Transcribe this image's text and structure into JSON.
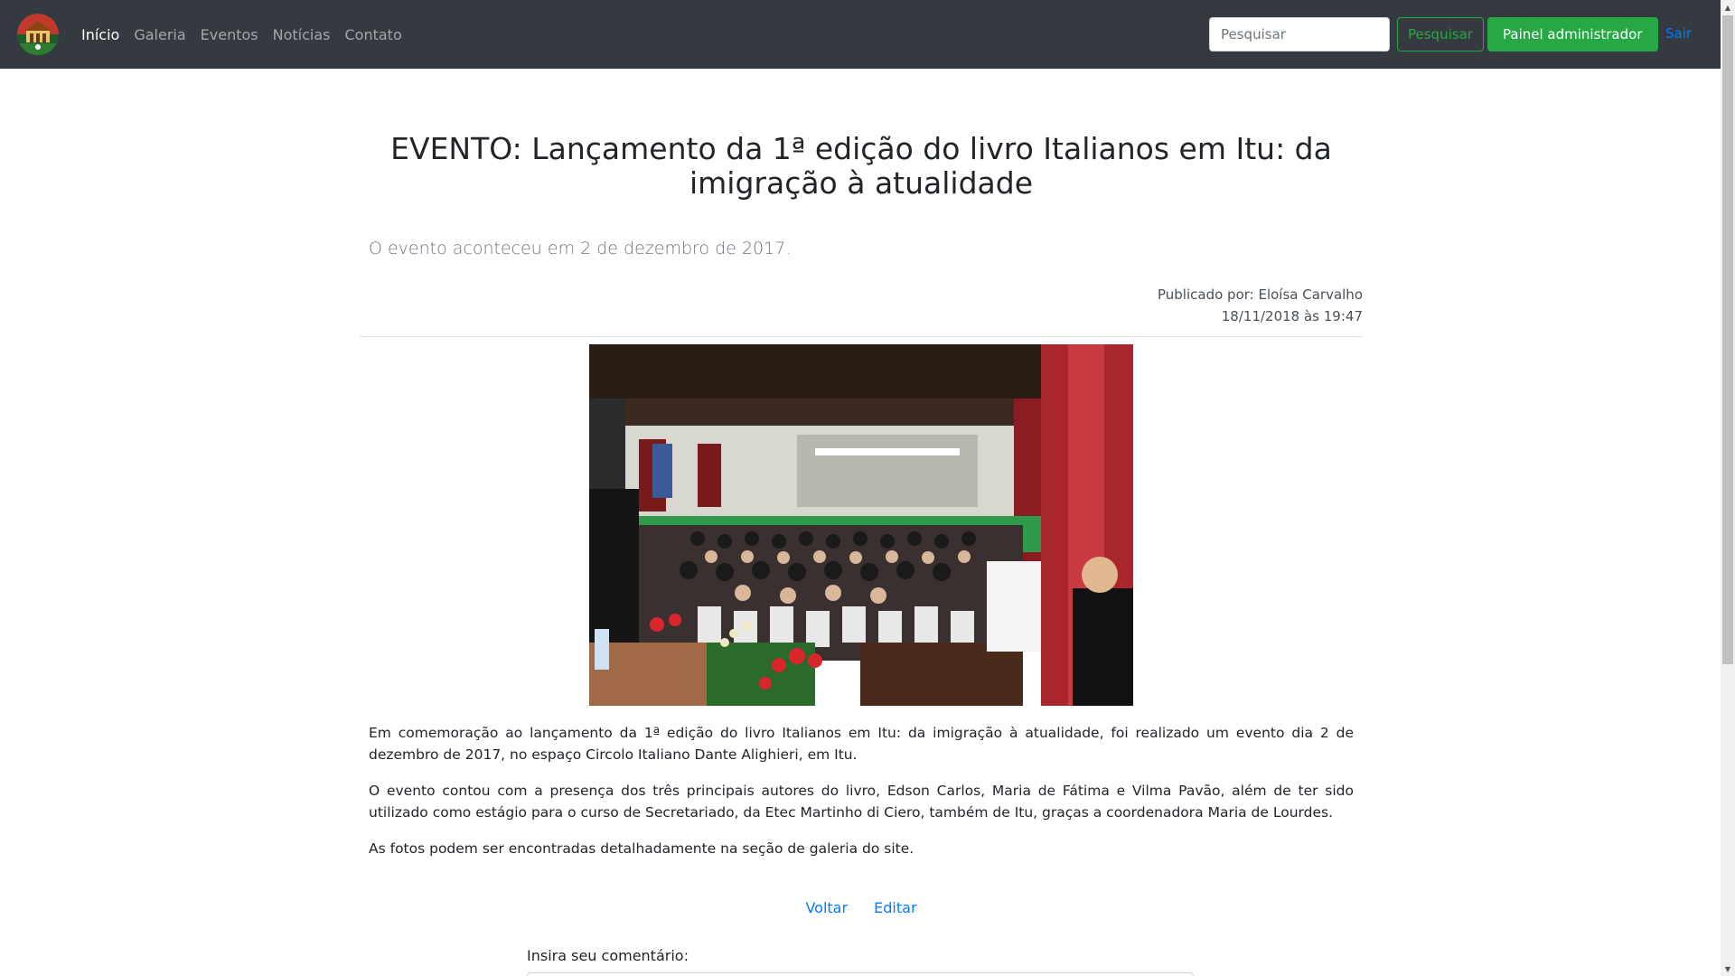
{
  "navbar": {
    "links": [
      {
        "label": "Início",
        "active": true
      },
      {
        "label": "Galeria",
        "active": false
      },
      {
        "label": "Eventos",
        "active": false
      },
      {
        "label": "Notícias",
        "active": false
      },
      {
        "label": "Contato",
        "active": false
      }
    ],
    "search_placeholder": "Pesquisar",
    "search_button": "Pesquisar",
    "admin_button": "Painel administrador",
    "logout": "Sair"
  },
  "post": {
    "title": "EVENTO: Lançamento da 1ª edição do livro Italianos em Itu: da imigração à atualidade",
    "subtitle": "O evento aconteceu em 2 de dezembro de 2017.",
    "author_line": "Publicado por: Eloísa Carvalho",
    "date_line": "18/11/2018 às 19:47",
    "image_alt": "Auditório com público sentado durante o lançamento do livro",
    "paragraphs": [
      "Em comemoração ao lançamento da 1ª edição do livro Italianos em Itu: da imigração à atualidade, foi realizado um evento dia 2 de dezembro de 2017, no espaço Circolo Italiano Dante Alighieri, em Itu.",
      "O evento contou com a presença dos três principais autores do livro, Edson Carlos, Maria de Fátima e Vilma Pavão, além de ter sido utilizado como estágio para o curso de Secretariado, da Etec Martinho di Ciero, também de Itu, graças a coordenadora Maria de Lourdes.",
      "As fotos podem ser encontradas detalhadamente na seção de galeria do site."
    ]
  },
  "actions": {
    "back": "Voltar",
    "edit": "Editar"
  },
  "comment": {
    "label": "Insira seu comentário:"
  },
  "colors": {
    "navbar_bg": "#343a40",
    "success": "#28a745",
    "link": "#007bff"
  }
}
